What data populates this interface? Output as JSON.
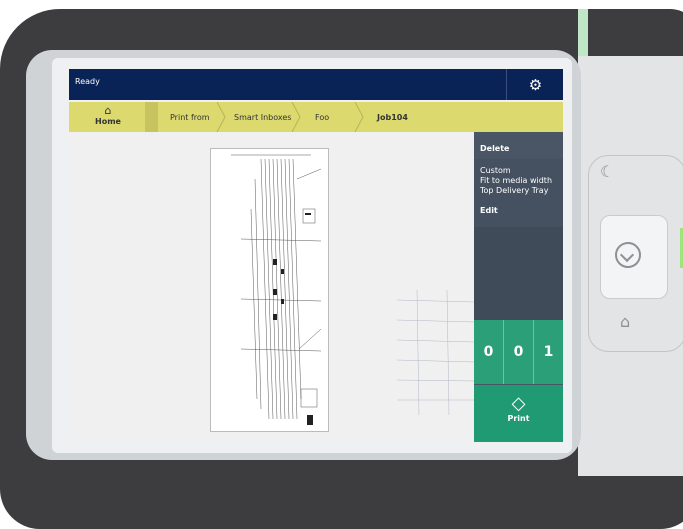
{
  "status": {
    "text": "Ready"
  },
  "topbar": {
    "settings_icon": "gear-icon"
  },
  "breadcrumb": {
    "home_label": "Home",
    "items": [
      "Print from",
      "Smart Inboxes",
      "Foo",
      "Job104"
    ]
  },
  "options": {
    "delete_label": "Delete",
    "settings_lines": [
      "Custom",
      "Fit to media width",
      "Top Delivery Tray"
    ],
    "edit_label": "Edit"
  },
  "counter": {
    "digits": [
      "0",
      "0",
      "1"
    ]
  },
  "print": {
    "label": "Print"
  },
  "colors": {
    "topbar": "#0a2356",
    "crumbbar": "#dcd96e",
    "panel": "#4a5666",
    "print": "#1f9a73"
  }
}
